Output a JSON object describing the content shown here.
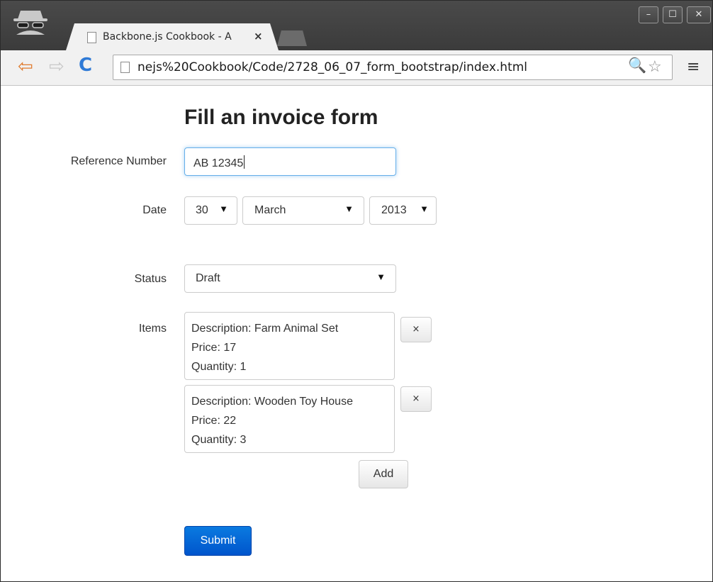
{
  "browser": {
    "tab_title": "Backbone.js Cookbook - A",
    "tab_close": "×",
    "url": "nejs%20Cookbook/Code/2728_06_07_form_bootstrap/index.html",
    "window_buttons": {
      "minimize": "–",
      "maximize": "☐",
      "close": "✕"
    },
    "nav": {
      "back": "⇦",
      "forward": "⇨",
      "reload": "C",
      "menu": "≡",
      "search": "🔍",
      "star": "☆"
    }
  },
  "form": {
    "heading": "Fill an invoice form",
    "reference": {
      "label": "Reference Number",
      "value": "AB 12345"
    },
    "date": {
      "label": "Date",
      "day": "30",
      "month": "March",
      "year": "2013",
      "caret": "▼"
    },
    "status": {
      "label": "Status",
      "value": "Draft"
    },
    "items": {
      "label": "Items",
      "list": [
        {
          "description": "Description: Farm Animal Set",
          "price": "Price: 17",
          "quantity": "Quantity: 1",
          "remove": "×"
        },
        {
          "description": "Description: Wooden Toy House",
          "price": "Price: 22",
          "quantity": "Quantity: 3",
          "remove": "×"
        }
      ],
      "add_label": "Add"
    },
    "submit_label": "Submit"
  },
  "colors": {
    "primary_button": "#0a6fd9",
    "focus_border": "#66afe9",
    "chrome_dark": "#3b3b3b"
  }
}
